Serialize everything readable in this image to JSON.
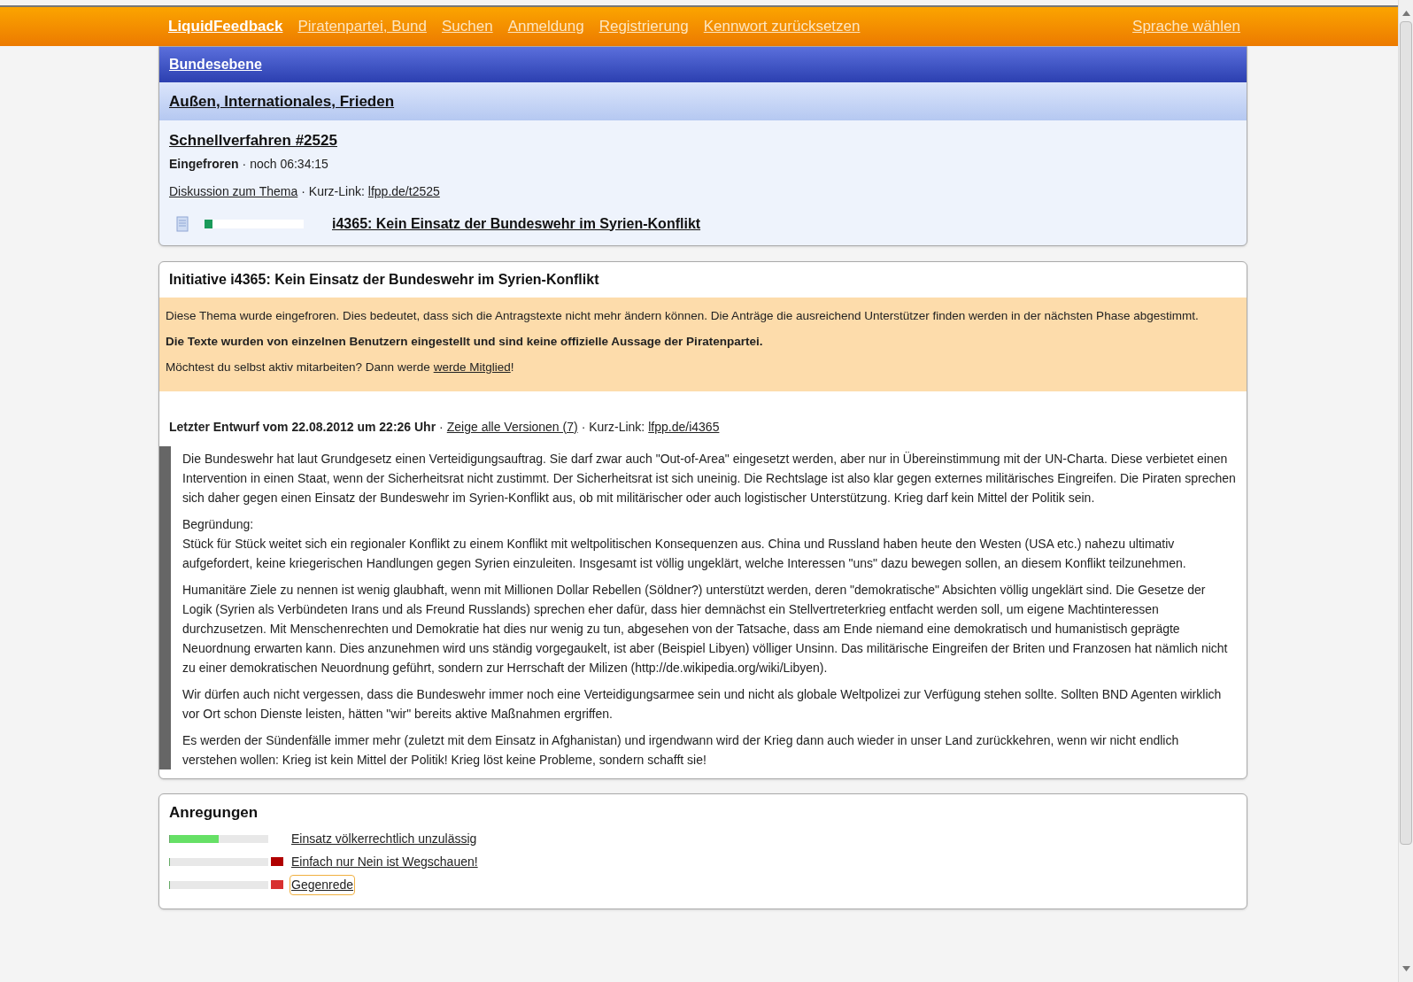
{
  "topbar": {
    "logo": "LiquidFeedback",
    "links": [
      "Piratenpartei, Bund",
      "Suchen",
      "Anmeldung",
      "Registrierung",
      "Kennwort zurücksetzen"
    ],
    "language": "Sprache wählen"
  },
  "breadcrumb": {
    "unit": "Bundesebene",
    "area": "Außen, Internationales, Frieden"
  },
  "issue": {
    "title": "Schnellverfahren #2525",
    "state": "Eingefroren",
    "remaining": "· noch 06:34:15",
    "discussion_link": "Diskussion zum Thema",
    "shortlink_label": "· Kurz-Link:",
    "shortlink": "lfpp.de/t2525",
    "initiative": {
      "level": 0.08,
      "title": "i4365: Kein Einsatz der Bundeswehr im Syrien-Konflikt"
    }
  },
  "initiative": {
    "heading": "Initiative i4365: Kein Einsatz der Bundeswehr im Syrien-Konflikt",
    "notice": {
      "text": "Diese Thema wurde eingefroren. Dies bedeutet, dass sich die Antragstexte nicht mehr ändern können. Die Anträge die ausreichend Unterstützer finden werden in der nächsten Phase abgestimmt.",
      "disclaimer": "Die Texte wurden von einzelnen Benutzern eingestellt und sind keine offizielle Aussage der Piratenpartei.",
      "join_text": "Möchtest du selbst aktiv mitarbeiten? Dann werde",
      "join_link": "werde Mitglied",
      "join_end": "!"
    },
    "draft": {
      "label": "Letzter Entwurf vom 22.08.2012 um 22:26 Uhr",
      "sep": "·",
      "versions_link": "Zeige alle Versionen (7)",
      "shortlink_label": "· Kurz-Link:",
      "shortlink": "lfpp.de/i4365"
    },
    "paragraphs": [
      "Die Bundeswehr hat laut Grundgesetz einen Verteidigungsauftrag. Sie darf zwar auch \"Out-of-Area\" eingesetzt werden, aber nur in Übereinstimmung mit der UN-Charta. Diese verbietet einen Intervention in einen Staat, wenn der Sicherheitsrat nicht zustimmt. Der Sicherheitsrat ist sich uneinig. Die Rechtslage ist also klar gegen externes militärisches Eingreifen. Die Piraten sprechen sich daher gegen einen Einsatz der Bundeswehr im Syrien-Konflikt aus, ob mit militärischer oder auch logistischer Unterstützung. Krieg darf kein Mittel der Politik sein.",
      "Begründung:\nStück für Stück weitet sich ein regionaler Konflikt zu einem Konflikt mit weltpolitischen Konsequenzen aus. China und Russland haben heute den Westen (USA etc.) nahezu ultimativ aufgefordert, keine kriegerischen Handlungen gegen Syrien einzuleiten. Insgesamt ist völlig ungeklärt, welche Interessen \"uns\" dazu bewegen sollen, an diesem Konflikt teilzunehmen.",
      "Humanitäre Ziele zu nennen ist wenig glaubhaft, wenn mit Millionen Dollar Rebellen (Söldner?) unterstützt werden, deren \"demokratische\" Absichten völlig ungeklärt sind. Die Gesetze der Logik (Syrien als Verbündeten Irans und als Freund Russlands) sprechen eher dafür, dass hier demnächst ein Stellvertreterkrieg entfacht werden soll, um eigene Machtinteressen durchzusetzen. Mit Menschenrechten und Demokratie hat dies nur wenig zu tun, abgesehen von der Tatsache, dass am Ende niemand eine demokratisch und humanistisch geprägte Neuordnung erwarten kann. Dies anzunehmen wird uns ständig vorgegaukelt, ist aber (Beispiel Libyen) völliger Unsinn. Das militärische Eingreifen der Briten und Franzosen hat nämlich nicht zu einer demokratischen Neuordnung geführt, sondern zur Herrschaft der Milizen (http://de.wikipedia.org/wiki/Libyen).",
      "Wir dürfen auch nicht vergessen, dass die Bundeswehr immer noch eine Verteidigungsarmee sein und nicht als globale Weltpolizei zur Verfügung stehen sollte. Sollten BND Agenten wirklich vor Ort schon Dienste leisten, hätten \"wir\" bereits aktive Maßnahmen ergriffen.",
      "Es werden der Sündenfälle immer mehr (zuletzt mit dem Einsatz in Afghanistan) und irgendwann wird der Krieg dann auch wieder in unser Land zurückkehren, wenn wir nicht endlich verstehen wollen: Krieg ist kein Mittel der Politik! Krieg löst keine Probleme, sondern schafft sie!"
    ]
  },
  "suggestions": {
    "heading": "Anregungen",
    "items": [
      {
        "title": "Einsatz völkerrechtlich unzulässig",
        "level": 0.5,
        "focused": false
      },
      {
        "title": "Einfach nur Nein ist Wegschauen!",
        "level": 0.01,
        "color": "#b00000",
        "focused": false
      },
      {
        "title": "Gegenrede",
        "level": 0,
        "color": "#d83030",
        "focused": true
      }
    ]
  }
}
